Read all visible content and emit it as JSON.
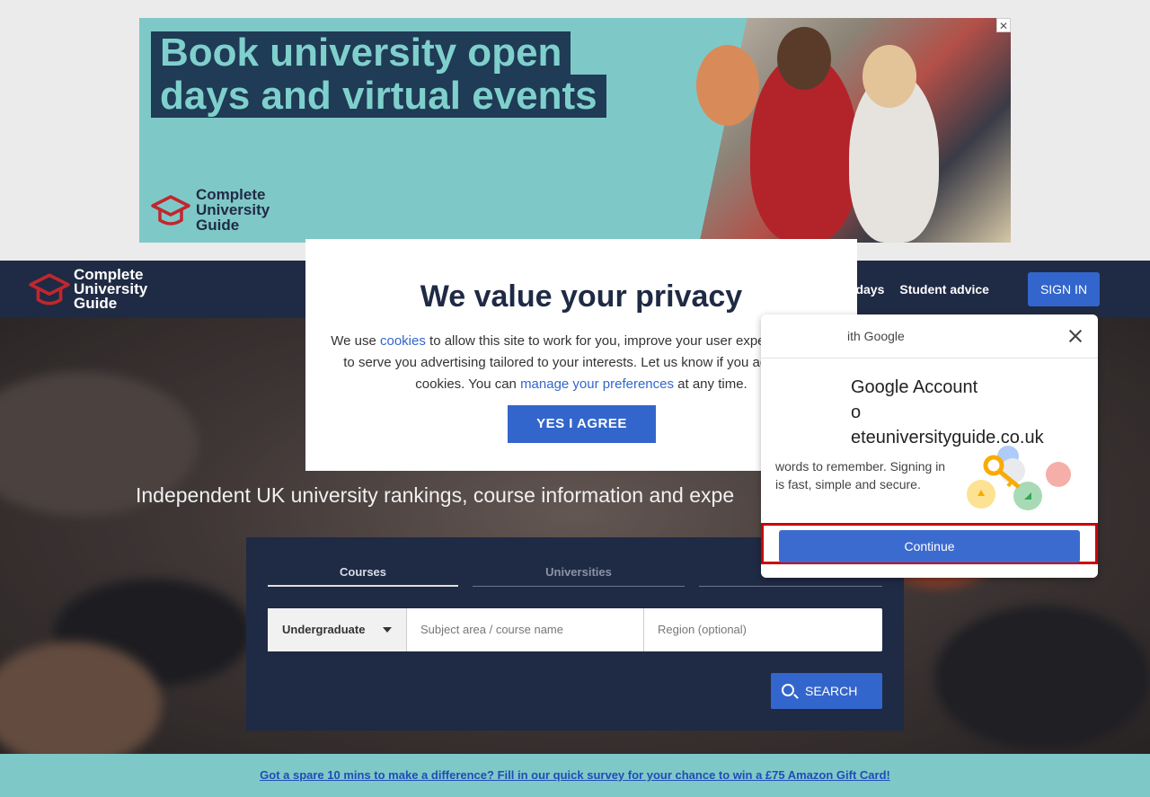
{
  "ad": {
    "headline_line1": "Book university open",
    "headline_line2": "days and virtual events",
    "logo_line1": "Complete",
    "logo_line2": "University",
    "logo_line3": "Guide",
    "close_label": "✕"
  },
  "nav": {
    "logo_line1": "Complete",
    "logo_line2": "University",
    "logo_line3": "Guide",
    "links": [
      "n days",
      "Student advice"
    ],
    "signin_label": "SIGN IN"
  },
  "hero": {
    "subtitle": "Independent UK university rankings, course information and expe"
  },
  "search": {
    "tabs": [
      "Courses",
      "Universities",
      ""
    ],
    "level_value": "Undergraduate",
    "subject_placeholder": "Subject area / course name",
    "region_placeholder": "Region (optional)",
    "search_label": "SEARCH"
  },
  "privacy": {
    "title": "We value your privacy",
    "body_1": "We use ",
    "cookies_link": "cookies",
    "body_2": " to allow this site to work for you, improve your user experience, and to serve you advertising tailored to your interests. Let us know if you agree to all cookies. You can ",
    "prefs_link": "manage your preferences",
    "body_3": " at any time.",
    "agree_label": "YES I AGREE"
  },
  "google": {
    "header": "ith Google",
    "title_line1": "Google Account",
    "title_line2": "o",
    "title_line3": "eteuniversityguide.co.uk",
    "desc": "words to remember. Signing in is fast, simple and secure.",
    "continue_label": "Continue"
  },
  "survey": {
    "text": "Got a spare 10 mins to make a difference? Fill in our quick survey for your chance to win a £75 Amazon Gift Card!"
  },
  "colors": {
    "navy": "#1f2a44",
    "accent_blue": "#3366cc",
    "teal": "#7fc8c8",
    "highlight_red": "#cc0000"
  }
}
